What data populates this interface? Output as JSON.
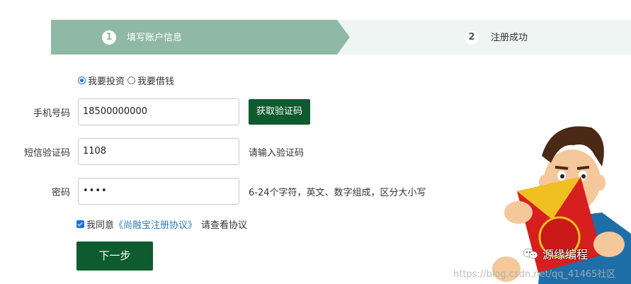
{
  "steps": [
    {
      "num": "1",
      "label": "填写账户信息"
    },
    {
      "num": "2",
      "label": "注册成功"
    }
  ],
  "role": {
    "options": [
      "我要投资",
      "我要借钱"
    ],
    "selected": "我要投资"
  },
  "form": {
    "phone_label": "手机号码",
    "phone_value": "18500000000",
    "get_code_label": "获取验证码",
    "sms_label": "短信验证码",
    "sms_value": "1108",
    "sms_hint": "请输入验证码",
    "password_label": "密码",
    "password_value": "••••",
    "password_hint": "6-24个字符，英文、数字组成，区分大小写"
  },
  "agreement": {
    "prefix": "我同意",
    "link": "《尚融宝注册协议》",
    "suffix": "请查看协议",
    "checked": true
  },
  "next_label": "下一步",
  "overlay": {
    "wechat_brand": "源缘编程",
    "watermark": "https://blog.csdn.net/qq_41465社区"
  },
  "colors": {
    "accent": "#0e5b30",
    "step_active": "#8fb9a6",
    "step_inactive": "#eef5f2",
    "link": "#2a7ab8"
  }
}
